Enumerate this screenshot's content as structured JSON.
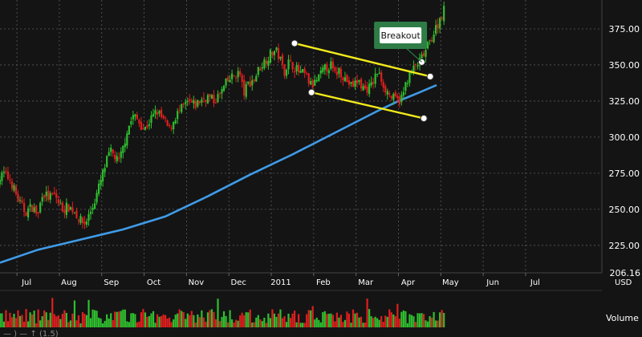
{
  "chart_data": {
    "type": "candlestick",
    "price_axis": {
      "ticks": [
        225,
        250,
        275,
        300,
        325,
        350,
        375
      ],
      "tick_labels": [
        "225.00",
        "250.00",
        "275.00",
        "300.00",
        "325.00",
        "350.00",
        "375.00"
      ],
      "current_low_label": "206.16",
      "unit": "USD",
      "range": [
        206,
        395
      ]
    },
    "time_axis": {
      "labels": [
        "Jul",
        "Aug",
        "Sep",
        "Oct",
        "Nov",
        "Dec",
        "2011",
        "Feb",
        "Mar",
        "Apr",
        "May",
        "Jun",
        "Jul"
      ],
      "month_index": [
        0,
        1,
        2,
        3,
        4,
        5,
        6,
        7,
        8,
        9,
        10,
        11,
        12
      ],
      "range_months": [
        -0.4,
        13.8
      ]
    },
    "price_path": [
      [
        -0.45,
        270
      ],
      [
        -0.3,
        275
      ],
      [
        -0.15,
        270
      ],
      [
        0.05,
        255
      ],
      [
        0.2,
        248
      ],
      [
        0.35,
        252
      ],
      [
        0.5,
        246
      ],
      [
        0.6,
        262
      ],
      [
        0.75,
        258
      ],
      [
        0.9,
        260
      ],
      [
        1.0,
        253
      ],
      [
        1.1,
        250
      ],
      [
        1.2,
        252
      ],
      [
        1.35,
        249
      ],
      [
        1.5,
        242
      ],
      [
        1.6,
        240
      ],
      [
        1.7,
        246
      ],
      [
        1.8,
        253
      ],
      [
        1.9,
        262
      ],
      [
        2.0,
        272
      ],
      [
        2.1,
        282
      ],
      [
        2.2,
        290
      ],
      [
        2.3,
        287
      ],
      [
        2.4,
        282
      ],
      [
        2.5,
        292
      ],
      [
        2.6,
        305
      ],
      [
        2.75,
        315
      ],
      [
        2.9,
        310
      ],
      [
        3.0,
        305
      ],
      [
        3.15,
        312
      ],
      [
        3.3,
        318
      ],
      [
        3.45,
        312
      ],
      [
        3.6,
        305
      ],
      [
        3.75,
        315
      ],
      [
        3.9,
        320
      ],
      [
        4.05,
        324
      ],
      [
        4.2,
        322
      ],
      [
        4.35,
        326
      ],
      [
        4.5,
        328
      ],
      [
        4.65,
        325
      ],
      [
        4.8,
        330
      ],
      [
        4.95,
        338
      ],
      [
        5.1,
        342
      ],
      [
        5.25,
        345
      ],
      [
        5.35,
        330
      ],
      [
        5.45,
        337
      ],
      [
        5.6,
        340
      ],
      [
        5.7,
        347
      ],
      [
        5.85,
        353
      ],
      [
        6.0,
        358
      ],
      [
        6.1,
        360
      ],
      [
        6.2,
        355
      ],
      [
        6.3,
        345
      ],
      [
        6.4,
        352
      ],
      [
        6.5,
        350
      ],
      [
        6.65,
        345
      ],
      [
        6.8,
        343
      ],
      [
        6.95,
        335
      ],
      [
        7.1,
        340
      ],
      [
        7.25,
        347
      ],
      [
        7.4,
        350
      ],
      [
        7.5,
        343
      ],
      [
        7.6,
        347
      ],
      [
        7.75,
        340
      ],
      [
        7.9,
        335
      ],
      [
        8.05,
        339
      ],
      [
        8.2,
        333
      ],
      [
        8.35,
        335
      ],
      [
        8.5,
        345
      ],
      [
        8.6,
        340
      ],
      [
        8.7,
        333
      ],
      [
        8.85,
        327
      ],
      [
        9.0,
        325
      ],
      [
        9.1,
        328
      ],
      [
        9.2,
        340
      ],
      [
        9.35,
        347
      ],
      [
        9.5,
        352
      ],
      [
        9.65,
        360
      ],
      [
        9.8,
        370
      ],
      [
        9.95,
        380
      ],
      [
        10.1,
        390
      ]
    ],
    "moving_average": {
      "month": [
        -0.4,
        0.5,
        1.5,
        2.5,
        3.5,
        4.5,
        5.5,
        6.5,
        7.5,
        8.5,
        9.0,
        9.5,
        9.9
      ],
      "value": [
        213,
        222,
        229,
        236,
        245,
        259,
        274,
        288,
        303,
        318,
        325,
        331,
        336
      ]
    },
    "trendlines": [
      {
        "from": [
          6.55,
          365
        ],
        "to": [
          9.75,
          342
        ]
      },
      {
        "from": [
          6.95,
          331
        ],
        "to": [
          9.6,
          313
        ]
      }
    ],
    "trend_markers": [
      {
        "month": 6.55,
        "value": 365
      },
      {
        "month": 9.75,
        "value": 342
      },
      {
        "month": 6.95,
        "value": 331
      },
      {
        "month": 9.6,
        "value": 313
      },
      {
        "month": 9.55,
        "value": 352
      }
    ],
    "annotation": {
      "label": "Breakout",
      "month": 9.05,
      "value": 360,
      "target": [
        9.55,
        352
      ]
    },
    "volume_label": "Volume",
    "footer_fragment": "— ) — ↑ (1.5)",
    "colors": {
      "background": "#141414",
      "up": "#2fbf2f",
      "down": "#e01e1e",
      "moving_average": "#3f9be8",
      "trendline": "#f2ea1b",
      "grid": "#5a5a5a",
      "annotation_border": "#2e7d46"
    }
  }
}
